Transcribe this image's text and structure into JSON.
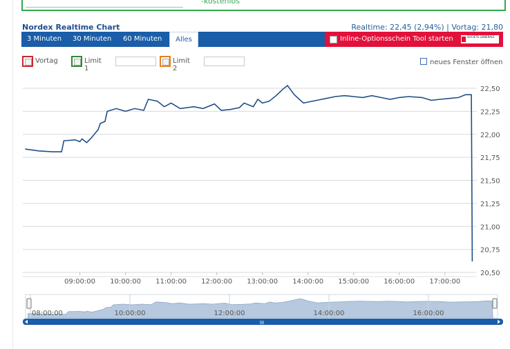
{
  "ad": {
    "text": "-kostenlos"
  },
  "header": {
    "title": "Nordex Realtime Chart",
    "realtime": "Realtime: 22,45 (2,94%) | Vortag: 21,80"
  },
  "tabs": [
    {
      "label": "3 Minuten"
    },
    {
      "label": "30 Minuten"
    },
    {
      "label": "60 Minuten"
    },
    {
      "label": "Alles"
    }
  ],
  "option_button": {
    "label": "Inline-Optionsschein Tool starten",
    "logo": "SOCIETE GENERALE"
  },
  "controls": {
    "vortag": "Vortag",
    "limit1": "Limit 1",
    "limit2": "Limit 2",
    "new_window": "neues Fenster öffnen"
  },
  "colors": {
    "line": "#1f4f86",
    "vortag_box": "#c8282d",
    "limit1_box": "#2e8b2e",
    "limit2_box": "#e5801e",
    "tabbar": "#1a5da8",
    "option_button": "#e2113a",
    "navigator_fill": "#b7c9df"
  },
  "navigator": {
    "labels": [
      "08:00:00",
      "10:00:00",
      "12:00:00",
      "14:00:00",
      "16:00:00"
    ],
    "scroll_label": "III"
  },
  "chart_data": {
    "type": "line",
    "series": [
      {
        "values": [
          [
            7.8,
            21.84
          ],
          [
            8.1,
            21.82
          ],
          [
            8.4,
            21.81
          ],
          [
            8.6,
            21.81
          ],
          [
            8.65,
            21.93
          ],
          [
            8.9,
            21.94
          ],
          [
            9.0,
            21.92
          ],
          [
            9.05,
            21.95
          ],
          [
            9.15,
            21.91
          ],
          [
            9.25,
            21.96
          ],
          [
            9.4,
            22.05
          ],
          [
            9.45,
            22.12
          ],
          [
            9.55,
            22.14
          ],
          [
            9.6,
            22.25
          ],
          [
            9.8,
            22.28
          ],
          [
            10.0,
            22.25
          ],
          [
            10.2,
            22.28
          ],
          [
            10.4,
            22.26
          ],
          [
            10.5,
            22.38
          ],
          [
            10.7,
            22.36
          ],
          [
            10.85,
            22.3
          ],
          [
            11.0,
            22.34
          ],
          [
            11.2,
            22.28
          ],
          [
            11.5,
            22.3
          ],
          [
            11.7,
            22.28
          ],
          [
            11.95,
            22.33
          ],
          [
            12.1,
            22.26
          ],
          [
            12.3,
            22.27
          ],
          [
            12.5,
            22.29
          ],
          [
            12.6,
            22.34
          ],
          [
            12.8,
            22.3
          ],
          [
            12.9,
            22.38
          ],
          [
            13.0,
            22.34
          ],
          [
            13.15,
            22.36
          ],
          [
            13.3,
            22.42
          ],
          [
            13.45,
            22.49
          ],
          [
            13.55,
            22.53
          ],
          [
            13.7,
            22.43
          ],
          [
            13.9,
            22.34
          ],
          [
            14.0,
            22.35
          ],
          [
            14.2,
            22.37
          ],
          [
            14.4,
            22.39
          ],
          [
            14.6,
            22.41
          ],
          [
            14.8,
            22.42
          ],
          [
            15.0,
            22.41
          ],
          [
            15.2,
            22.4
          ],
          [
            15.4,
            22.42
          ],
          [
            15.6,
            22.4
          ],
          [
            15.8,
            22.38
          ],
          [
            16.0,
            22.4
          ],
          [
            16.2,
            22.41
          ],
          [
            16.5,
            22.4
          ],
          [
            16.7,
            22.37
          ],
          [
            16.9,
            22.38
          ],
          [
            17.1,
            22.39
          ],
          [
            17.3,
            22.4
          ],
          [
            17.45,
            22.43
          ],
          [
            17.58,
            22.43
          ],
          [
            17.6,
            20.62
          ]
        ]
      }
    ],
    "x_ticks": [
      "09:00:00",
      "10:00:00",
      "11:00:00",
      "12:00:00",
      "13:00:00",
      "14:00:00",
      "15:00:00",
      "16:00:00",
      "17:00:00"
    ],
    "x_tick_values": [
      9,
      10,
      11,
      12,
      13,
      14,
      15,
      16,
      17
    ],
    "y_ticks": [
      "22,50",
      "22,25",
      "22,00",
      "21,75",
      "21,50",
      "21,25",
      "21,00",
      "20,75",
      "20,50"
    ],
    "y_tick_values": [
      22.5,
      22.25,
      22.0,
      21.75,
      21.5,
      21.25,
      21.0,
      20.75,
      20.5
    ],
    "xlim": [
      7.75,
      17.7
    ],
    "ylim": [
      20.5,
      22.5
    ],
    "grid": true,
    "title": "Nordex Realtime Chart",
    "xlabel": "",
    "ylabel": ""
  }
}
